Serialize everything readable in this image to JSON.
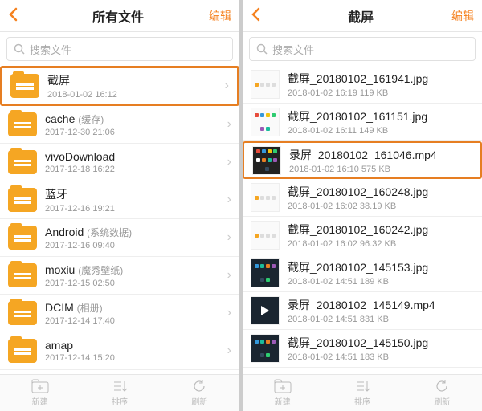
{
  "left": {
    "title": "所有文件",
    "edit": "编辑",
    "searchPlaceholder": "搜索文件",
    "folders": [
      {
        "name": "截屏",
        "sub": "",
        "meta": "2018-01-02 16:12",
        "hl": true
      },
      {
        "name": "cache",
        "sub": "(缓存)",
        "meta": "2017-12-30 21:06"
      },
      {
        "name": "vivoDownload",
        "sub": "",
        "meta": "2017-12-18 16:22"
      },
      {
        "name": "蓝牙",
        "sub": "",
        "meta": "2017-12-16 19:21"
      },
      {
        "name": "Android",
        "sub": "(系统数据)",
        "meta": "2017-12-16 09:40"
      },
      {
        "name": "moxiu",
        "sub": "(魔秀壁纸)",
        "meta": "2017-12-15 02:50"
      },
      {
        "name": "DCIM",
        "sub": "(相册)",
        "meta": "2017-12-14 17:40"
      },
      {
        "name": "amap",
        "sub": "",
        "meta": "2017-12-14 15:20"
      }
    ],
    "bottom": {
      "new": "新建",
      "sort": "排序",
      "refresh": "刷新"
    }
  },
  "right": {
    "title": "截屏",
    "edit": "编辑",
    "searchPlaceholder": "搜索文件",
    "files": [
      {
        "name": "截屏_20180102_161941.jpg",
        "meta": "2018-01-02 16:19   119 KB",
        "thumb": "light"
      },
      {
        "name": "截屏_20180102_161151.jpg",
        "meta": "2018-01-02 16:11   149 KB",
        "thumb": "icons"
      },
      {
        "name": "录屏_20180102_161046.mp4",
        "meta": "2018-01-02 16:10   575 KB",
        "thumb": "apps",
        "hl": true
      },
      {
        "name": "截屏_20180102_160248.jpg",
        "meta": "2018-01-02 16:02   38.19 KB",
        "thumb": "light"
      },
      {
        "name": "截屏_20180102_160242.jpg",
        "meta": "2018-01-02 16:02   96.32 KB",
        "thumb": "light"
      },
      {
        "name": "截屏_20180102_145153.jpg",
        "meta": "2018-01-02 14:51   189 KB",
        "thumb": "dark"
      },
      {
        "name": "录屏_20180102_145149.mp4",
        "meta": "2018-01-02 14:51   831 KB",
        "thumb": "play"
      },
      {
        "name": "截屏_20180102_145150.jpg",
        "meta": "2018-01-02 14:51   183 KB",
        "thumb": "dark"
      }
    ],
    "bottom": {
      "new": "新建",
      "sort": "排序",
      "refresh": "刷新"
    }
  }
}
